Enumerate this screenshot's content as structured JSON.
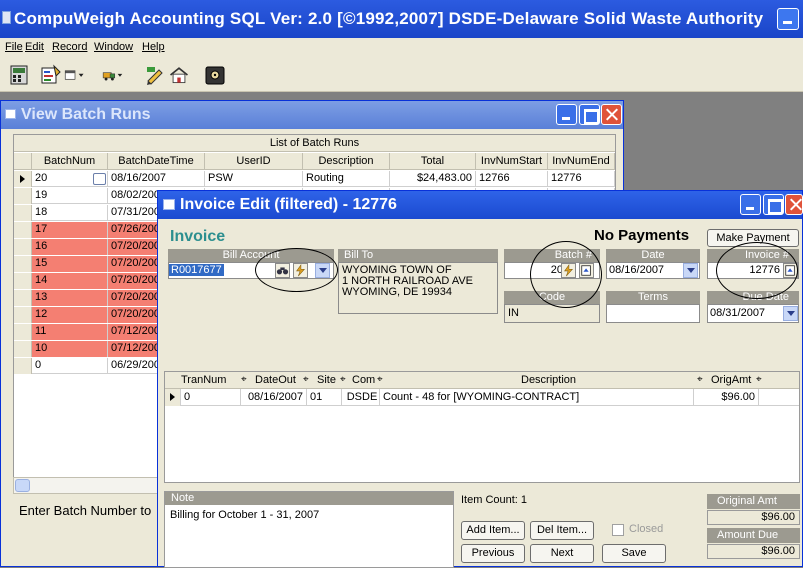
{
  "app": {
    "title": "CompuWeigh Accounting SQL Ver: 2.0 [©1992,2007] DSDE-Delaware Solid Waste Authority"
  },
  "menu": [
    "File",
    "Edit",
    "Record",
    "Window",
    "Help"
  ],
  "toolbar": {
    "icons": [
      "calculator-icon",
      "report-icon",
      "window-dropdown-icon",
      "truck-dropdown-icon",
      "pencil-icon",
      "house-icon",
      "safe-icon"
    ]
  },
  "batch_window": {
    "title": "View Batch Runs",
    "list_caption": "List of Batch Runs",
    "columns": [
      "BatchNum",
      "BatchDateTime",
      "UserID",
      "Description",
      "Total",
      "InvNumStart",
      "InvNumEnd"
    ],
    "rows": [
      {
        "num": "20",
        "date": "08/16/2007",
        "user": "PSW",
        "desc": "Routing",
        "total": "$24,483.00",
        "start": "12766",
        "end": "12776",
        "highlight": false,
        "selected": true
      },
      {
        "num": "19",
        "date": "08/02/2007",
        "highlight": false
      },
      {
        "num": "18",
        "date": "07/31/2007",
        "highlight": false
      },
      {
        "num": "17",
        "date": "07/26/2007",
        "highlight": true
      },
      {
        "num": "16",
        "date": "07/20/2007",
        "highlight": true
      },
      {
        "num": "15",
        "date": "07/20/2007",
        "highlight": true
      },
      {
        "num": "14",
        "date": "07/20/2007",
        "highlight": true
      },
      {
        "num": "13",
        "date": "07/20/2007",
        "highlight": true
      },
      {
        "num": "12",
        "date": "07/20/2007",
        "highlight": true
      },
      {
        "num": "11",
        "date": "07/12/2007",
        "highlight": true
      },
      {
        "num": "10",
        "date": "07/12/2007",
        "highlight": true
      },
      {
        "num": "0",
        "date": "06/29/2007",
        "highlight": false
      }
    ],
    "status_text": "Enter Batch Number to"
  },
  "invoice_window": {
    "title": "Invoice Edit (filtered) - 12776",
    "heading": "Invoice",
    "payment_status": "No Payments",
    "make_payment_label": "Make Payment",
    "bill_account_label": "Bill Account",
    "bill_account_value": "R0017677",
    "bill_to_label": "Bill To",
    "bill_to_lines": [
      "WYOMING TOWN OF",
      "1 NORTH RAILROAD AVE",
      "WYOMING, DE 19934"
    ],
    "batch_label": "Batch #",
    "batch_value": "20",
    "date_label": "Date",
    "date_value": "08/16/2007",
    "invoice_label": "Invoice #",
    "invoice_value": "12776",
    "code_label": "Code",
    "code_value": "IN",
    "terms_label": "Terms",
    "terms_value": "",
    "due_date_label": "Due Date",
    "due_date_value": "08/31/2007",
    "detail_columns": [
      "TranNum",
      "DateOut",
      "Site",
      "Com",
      "Description",
      "OrigAmt"
    ],
    "detail_rows": [
      {
        "tran": "0",
        "date": "08/16/2007",
        "site": "01",
        "com": "DSDE",
        "desc": "Count - 48 for [WYOMING-CONTRACT]",
        "amt": "$96.00"
      }
    ],
    "note_label": "Note",
    "note_value": "Billing for October 1 - 31, 2007",
    "item_count": "Item Count: 1",
    "add_item_label": "Add Item...",
    "del_item_label": "Del Item...",
    "closed_label": "Closed",
    "previous_label": "Previous",
    "next_label": "Next",
    "save_label": "Save",
    "original_amt_label": "Original Amt",
    "original_amt_value": "$96.00",
    "amount_due_label": "Amount Due",
    "amount_due_value": "$96.00"
  }
}
